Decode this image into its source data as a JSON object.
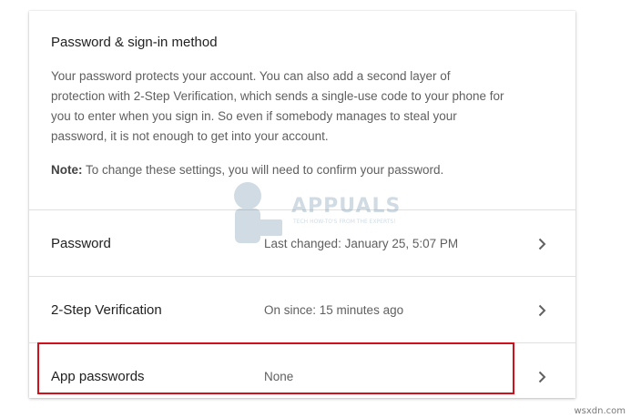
{
  "card": {
    "title": "Password & sign-in method",
    "description": "Your password protects your account. You can also add a second layer of protection with 2-Step Verification, which sends a single-use code to your phone for you to enter when you sign in. So even if somebody manages to steal your password, it is not enough to get into your account.",
    "note_label": "Note:",
    "note_text": " To change these settings, you will need to confirm your password."
  },
  "rows": [
    {
      "label": "Password",
      "value": "Last changed: January 25, 5:07 PM",
      "icon": "chevron-right-icon"
    },
    {
      "label": "2-Step Verification",
      "value": "On since: 15 minutes ago",
      "icon": "chevron-right-icon"
    },
    {
      "label": "App passwords",
      "value": "None",
      "icon": "chevron-right-icon"
    }
  ],
  "watermark": {
    "brand": "APPUALS",
    "tagline": "TECH HOW-TO'S FROM THE EXPERTS!"
  },
  "credit": "wsxdn.com",
  "colors": {
    "highlight_border": "#d0101a",
    "divider": "#e0e0e0",
    "title_text": "#212121",
    "secondary_text": "#5f5f5f"
  }
}
